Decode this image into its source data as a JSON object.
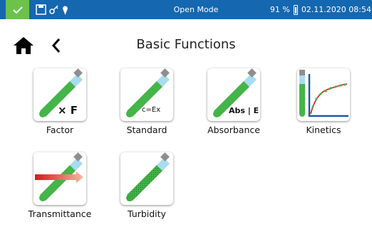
{
  "status": {
    "mode": "Open Mode",
    "battery": "91 %",
    "date_time": "02.11.2020 08:54",
    "accent_bg": "#1567b0",
    "check_color": "#6cc24a"
  },
  "header": {
    "title": "Basic Functions"
  },
  "tiles": [
    {
      "label": "Factor",
      "overlay": "× F"
    },
    {
      "label": "Standard",
      "overlay": "c=Ex"
    },
    {
      "label": "Absorbance",
      "overlay": "Abs | E"
    },
    {
      "label": "Kinetics"
    },
    {
      "label": "Transmittance"
    },
    {
      "label": "Turbidity"
    }
  ]
}
